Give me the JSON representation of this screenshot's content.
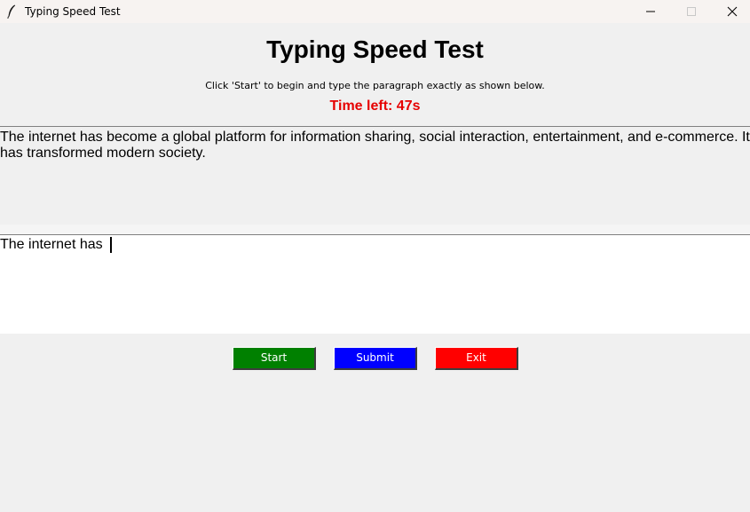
{
  "window": {
    "title": "Typing Speed Test",
    "icon": "feather-icon",
    "controls": [
      "minimize-icon",
      "maximize-icon",
      "close-icon"
    ]
  },
  "header": {
    "heading": "Typing Speed Test",
    "instructions": "Click 'Start' to begin and type the paragraph exactly as shown below.",
    "timer": "Time left: 47s"
  },
  "paragraph": {
    "text": "The internet has become a global platform for information sharing, social interaction, entertainment, and e-commerce. It has transformed modern society."
  },
  "typing_area": {
    "value": "The internet has "
  },
  "buttons": {
    "start": {
      "label": "Start",
      "color": "#008000"
    },
    "submit": {
      "label": "Submit",
      "color": "#0000ff"
    },
    "exit": {
      "label": "Exit",
      "color": "#ff0000"
    }
  },
  "colors": {
    "timer": "#e60000",
    "background": "#f0f0f0"
  }
}
